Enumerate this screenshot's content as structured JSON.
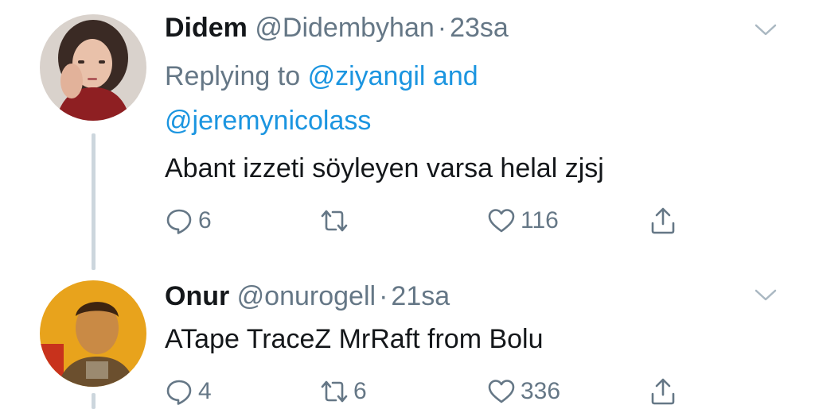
{
  "tweets": [
    {
      "name": "Didem",
      "handle": "@Didembyhan",
      "separator": "·",
      "time": "23sa",
      "replying_prefix": "Replying to",
      "replying_mention_1": "@ziyangil",
      "replying_and": "and",
      "replying_mention_2": "@jeremynicolass",
      "text": "Abant izzeti söyleyen varsa helal zjsj",
      "reply_count": "6",
      "retweet_count": "",
      "like_count": "116"
    },
    {
      "name": "Onur",
      "handle": "@onurogell",
      "separator": "·",
      "time": "21sa",
      "text": "ATape TraceZ MrRaft from Bolu",
      "reply_count": "4",
      "retweet_count": "6",
      "like_count": "336"
    }
  ],
  "icons": {
    "reply": "reply-icon",
    "retweet": "retweet-icon",
    "like": "heart-icon",
    "share": "share-icon",
    "menu": "chevron-down-icon"
  },
  "colors": {
    "text": "#14171a",
    "secondary": "#657786",
    "link": "#1b95e0",
    "thread_line": "#ccd6dd"
  }
}
